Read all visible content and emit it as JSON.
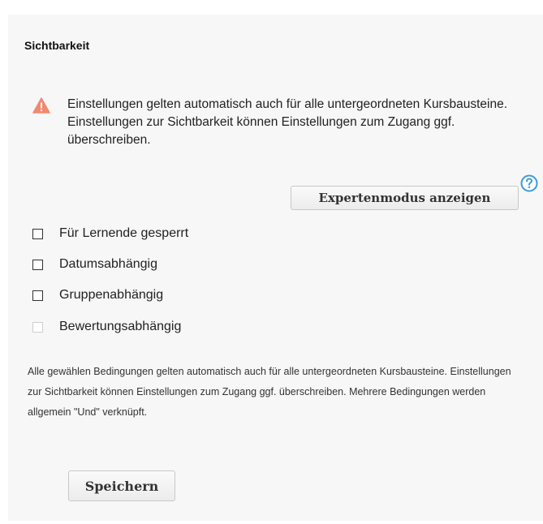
{
  "section": {
    "title": "Sichtbarkeit"
  },
  "warning": {
    "icon": "warning-triangle-icon",
    "color": "#f2896f",
    "text": "Einstellungen gelten automatisch auch für alle untergeordneten Kursbausteine. Einstellungen zur Sichtbarkeit können Einstellungen zum Zugang ggf. überschreiben."
  },
  "help": {
    "icon": "help-circle-icon",
    "color": "#3a9bd8"
  },
  "expert_button": {
    "label": "Expertenmodus anzeigen"
  },
  "conditions": [
    {
      "label": "Für Lernende gesperrt",
      "checked": false,
      "enabled": true
    },
    {
      "label": "Datumsabhängig",
      "checked": false,
      "enabled": true
    },
    {
      "label": "Gruppenabhängig",
      "checked": false,
      "enabled": true
    },
    {
      "label": "Bewertungsabhängig",
      "checked": false,
      "enabled": false
    }
  ],
  "note": {
    "text": "Alle gewählen Bedingungen gelten automatisch auch für alle untergeordneten Kursbausteine. Einstellungen zur Sichtbarkeit können Einstellungen zum Zugang ggf. überschreiben. Mehrere Bedingungen werden allgemein \"Und\" verknüpft."
  },
  "save_button": {
    "label": "Speichern"
  }
}
